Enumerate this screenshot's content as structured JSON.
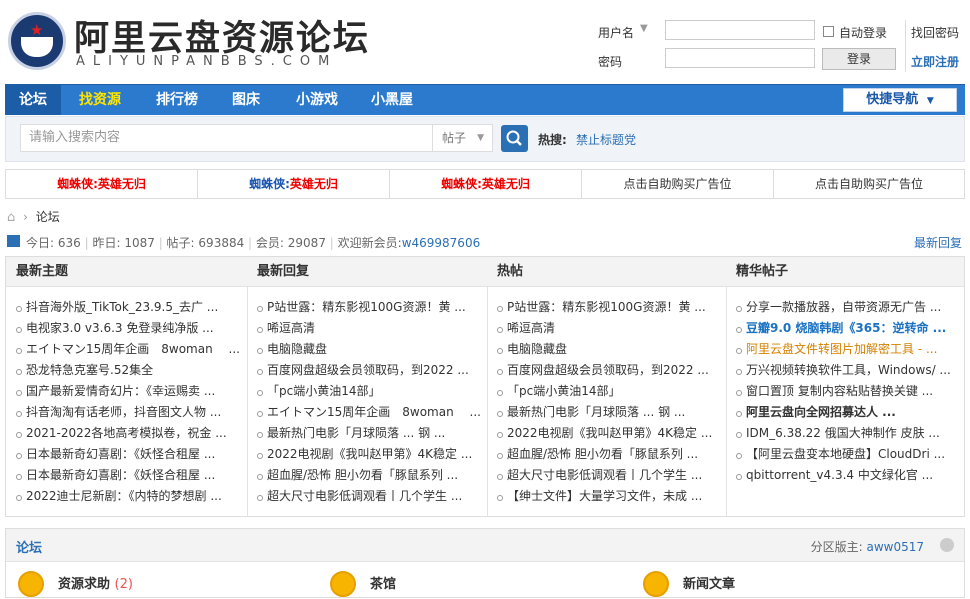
{
  "site": {
    "title": "阿里云盘资源论坛",
    "subtitle": "ALIYUNPANBBS.COM"
  },
  "login": {
    "username_label": "用户名",
    "password_label": "密码",
    "auto_login": "自动登录",
    "login_button": "登录",
    "forgot_password": "找回密码",
    "register": "立即注册"
  },
  "nav": {
    "items": [
      "论坛",
      "找资源",
      "排行榜",
      "图床",
      "小游戏",
      "小黑屋"
    ],
    "quick_nav": "快捷导航"
  },
  "search": {
    "placeholder": "请输入搜索内容",
    "type": "帖子",
    "hot_label": "热搜:",
    "hot_link": "禁止标题党"
  },
  "ads": [
    {
      "prefix": "蜘蛛侠:",
      "text": "英雄无归",
      "style": "red"
    },
    {
      "prefix": "蜘蛛侠:",
      "text": "英雄无归",
      "style": "blue"
    },
    {
      "prefix": "蜘蛛侠:",
      "text": "英雄无归",
      "style": "red"
    },
    {
      "prefix": "",
      "text": "点击自助购买广告位",
      "style": "plain"
    },
    {
      "prefix": "",
      "text": "点击自助购买广告位",
      "style": "plain"
    }
  ],
  "breadcrumb": {
    "current": "论坛"
  },
  "stats": {
    "today_label": "今日:",
    "today": "636",
    "yesterday_label": "昨日:",
    "yesterday": "1087",
    "posts_label": "帖子:",
    "posts": "693884",
    "members_label": "会员:",
    "members": "29087",
    "welcome_label": "欢迎新会员:",
    "new_member": "w469987606",
    "latest_reply": "最新回复"
  },
  "portal": {
    "columns": [
      {
        "title": "最新主题",
        "items": [
          {
            "text": "抖音海外版_TikTok_23.9.5_去广 ...",
            "style": ""
          },
          {
            "text": "电视家3.0 v3.6.3 免登录纯净版 ...",
            "style": ""
          },
          {
            "text": "エイトマン15周年企画　8woman　 ...",
            "style": ""
          },
          {
            "text": "恐龙特急克塞号.52集全",
            "style": ""
          },
          {
            "text": "国产最新爱情奇幻片：《幸运赐卖 ...",
            "style": ""
          },
          {
            "text": "抖音淘淘有话老师，抖音图文人物 ...",
            "style": ""
          },
          {
            "text": "2021-2022各地高考模拟卷，祝金 ...",
            "style": ""
          },
          {
            "text": "日本最新奇幻喜剧：《妖怪合租屋 ...",
            "style": ""
          },
          {
            "text": "日本最新奇幻喜剧：《妖怪合租屋 ...",
            "style": ""
          },
          {
            "text": "2022迪士尼新剧：《内特的梦想剧 ...",
            "style": ""
          }
        ]
      },
      {
        "title": "最新回复",
        "items": [
          {
            "text": "P站世露：精东影视100G资源！黄 ...",
            "style": ""
          },
          {
            "text": "唏逗高清",
            "style": ""
          },
          {
            "text": "电脑隐藏盘",
            "style": ""
          },
          {
            "text": "百度网盘超级会员领取码，到2022 ...",
            "style": ""
          },
          {
            "text": "「pc端小黄油14部」",
            "style": ""
          },
          {
            "text": "エイトマン15周年企画　8woman　 ...",
            "style": ""
          },
          {
            "text": "最新热门电影「月球陨落 ... 钢 ...",
            "style": ""
          },
          {
            "text": "2022电视剧《我叫赵甲第》4K稳定 ...",
            "style": ""
          },
          {
            "text": "超血腥/恐怖 胆小勿看「豚鼠系列 ...",
            "style": ""
          },
          {
            "text": "超大尺寸电影低调观看丨几个学生 ...",
            "style": ""
          }
        ]
      },
      {
        "title": "热帖",
        "items": [
          {
            "text": "P站世露：精东影视100G资源！黄 ...",
            "style": ""
          },
          {
            "text": "唏逗高清",
            "style": ""
          },
          {
            "text": "电脑隐藏盘",
            "style": ""
          },
          {
            "text": "百度网盘超级会员领取码，到2022 ...",
            "style": ""
          },
          {
            "text": "「pc端小黄油14部」",
            "style": ""
          },
          {
            "text": "最新热门电影「月球陨落 ... 钢 ...",
            "style": ""
          },
          {
            "text": "2022电视剧《我叫赵甲第》4K稳定 ...",
            "style": ""
          },
          {
            "text": "超血腥/恐怖 胆小勿看「豚鼠系列 ...",
            "style": ""
          },
          {
            "text": "超大尺寸电影低调观看丨几个学生 ...",
            "style": ""
          },
          {
            "text": "【绅士文件】大量学习文件，未成 ...",
            "style": ""
          }
        ]
      },
      {
        "title": "精华帖子",
        "items": [
          {
            "text": "分享一款播放器，自带资源无广告 ...",
            "style": ""
          },
          {
            "text": "豆瓣9.0 烧脑韩剧《365：逆转命 ...",
            "style": "blue-b"
          },
          {
            "text": "阿里云盘文件转图片加解密工具 - ...",
            "style": "orange"
          },
          {
            "text": "万兴视频转换软件工具，Windows/ ...",
            "style": ""
          },
          {
            "text": "窗口置顶 复制内容粘贴替换关键 ...",
            "style": ""
          },
          {
            "text": "阿里云盘向全网招募达人 ...",
            "style": "bold"
          },
          {
            "text": "IDM_6.38.22 俄国大神制作 皮肤 ...",
            "style": ""
          },
          {
            "text": "【阿里云盘变本地硬盘】CloudDri ...",
            "style": ""
          },
          {
            "text": "qbittorrent_v4.3.4 中文绿化官 ...",
            "style": ""
          }
        ]
      }
    ]
  },
  "forum": {
    "title": "论坛",
    "moderator_label": "分区版主:",
    "moderator": "aww0517",
    "boards": [
      {
        "name": "资源求助",
        "count": "(2)"
      },
      {
        "name": "茶馆",
        "count": ""
      },
      {
        "name": "新闻文章",
        "count": ""
      }
    ]
  }
}
